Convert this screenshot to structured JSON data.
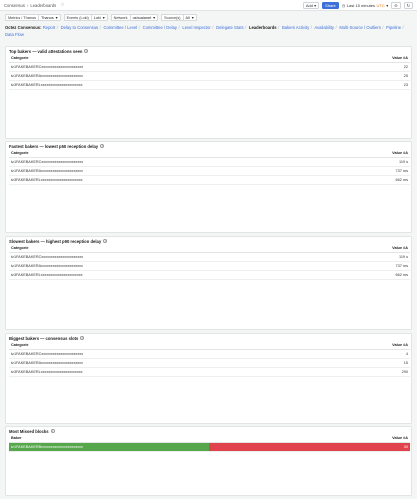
{
  "topbar": {
    "breadcrumb": [
      "Consensus",
      "Leaderboards"
    ],
    "add_label": "Add",
    "share_label": "Share",
    "time_range": "Last 15 minutes",
    "timezone": "UTC"
  },
  "variables": [
    {
      "label": "Metrics / Thanos",
      "value": "Thanos"
    },
    {
      "label": "Events (Loki)",
      "value": "Loki"
    },
    {
      "label": "Network",
      "value": "ushuaianet"
    },
    {
      "label": "Source(s)",
      "value": "All"
    }
  ],
  "links": {
    "heading": "Octez Consensus:",
    "items": [
      "Report",
      "Delay to Consensus",
      "Committee / Level",
      "Committee / Delay",
      "Level Inspector",
      "Delegate Stats",
      "Leaderboards",
      "Bakers Activity",
      "Availability",
      "Multi-Source / Outliers",
      "Pipeline",
      "Data Flow"
    ],
    "active": "Leaderboards"
  },
  "panels": [
    {
      "title": "Top bakers — valid attestations seen",
      "col_left": "Categorie",
      "col_right": "Value #A",
      "rows": [
        {
          "name": "tz1FAKEBAKERCxxxxxxxxxxxxxxxxxxxxxx",
          "value": "22"
        },
        {
          "name": "tz1FAKEBAKERAxxxxxxxxxxxxxxxxxxxxxx",
          "value": "25"
        },
        {
          "name": "tz3FAKEBAKERLxxxxxxxxxxxxxxxxxxxxxx",
          "value": "23"
        }
      ]
    },
    {
      "title": "Fastest bakers — lowest p50 reception delay",
      "col_left": "Categorie",
      "col_right": "Value #A",
      "rows": [
        {
          "name": "tz1FAKEBAKERCxxxxxxxxxxxxxxxxxxxxxx",
          "value": "119 s"
        },
        {
          "name": "tz1FAKEBAKERAxxxxxxxxxxxxxxxxxxxxxx",
          "value": "737 ms"
        },
        {
          "name": "tz3FAKEBAKERLxxxxxxxxxxxxxxxxxxxxxx",
          "value": "662 ms"
        }
      ]
    },
    {
      "title": "Slowest bakers — highest p90 reception delay",
      "col_left": "Categorie",
      "col_right": "Value #A",
      "rows": [
        {
          "name": "tz1FAKEBAKERCxxxxxxxxxxxxxxxxxxxxxx",
          "value": "119 s"
        },
        {
          "name": "tz1FAKEBAKERAxxxxxxxxxxxxxxxxxxxxxx",
          "value": "737 ms"
        },
        {
          "name": "tz3FAKEBAKERLxxxxxxxxxxxxxxxxxxxxxx",
          "value": "662 ms"
        }
      ]
    },
    {
      "title": "Biggest bakers — consensus slots",
      "col_left": "Categorie",
      "col_right": "Value #A",
      "rows": [
        {
          "name": "tz1FAKEBAKERCxxxxxxxxxxxxxxxxxxxxxx",
          "value": "4"
        },
        {
          "name": "tz1FAKEBAKERAxxxxxxxxxxxxxxxxxxxxxx",
          "value": "15"
        },
        {
          "name": "tz3FAKEBAKERLxxxxxxxxxxxxxxxxxxxxxx",
          "value": "290"
        }
      ]
    },
    {
      "title": "Most Missed blocks",
      "col_left": "Baker",
      "col_right": "Value #A",
      "rows": [
        {
          "name": "tz1FAKEBAKERBxxxxxxxxxxxxxxxxxxxxxx",
          "value": "30"
        }
      ]
    }
  ],
  "colors": {
    "accent": "#3d71d9",
    "green": "#56a64b",
    "red": "#e0434c",
    "utc": "#e5780b"
  }
}
